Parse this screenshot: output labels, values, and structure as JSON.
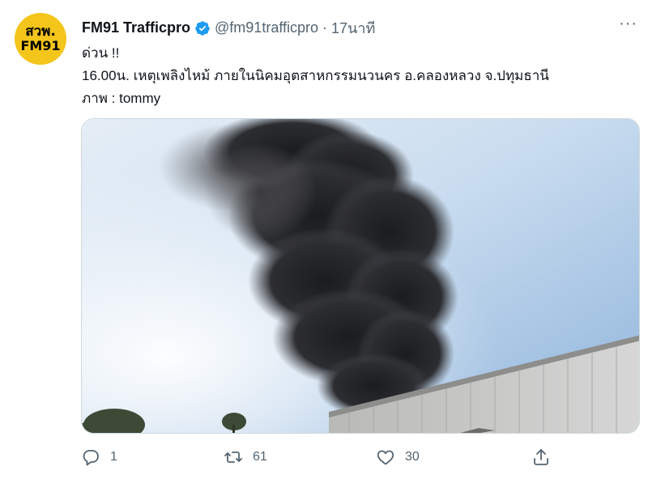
{
  "tweet": {
    "avatar": {
      "line1": "สวพ.",
      "line2": "FM91"
    },
    "author_name": "FM91 Trafficpro",
    "handle": "@fm91trafficpro",
    "separator": "·",
    "time": "17นาที",
    "more_label": "···",
    "text_lines": [
      "ด่วน !!",
      "16.00น. เหตุเพลิงไหม้  ภายในนิคมอุตสาหกรรมนวนคร  อ.คลองหลวง จ.ปทุมธานี",
      "ภาพ : tommy"
    ],
    "media_description": "smoke-photo",
    "reply_count": "1",
    "retweet_count": "61",
    "like_count": "30"
  },
  "colors": {
    "text": "#0f1419",
    "secondary": "#536471",
    "verified": "#1d9bf0",
    "avatar_bg": "#f4c51a"
  }
}
